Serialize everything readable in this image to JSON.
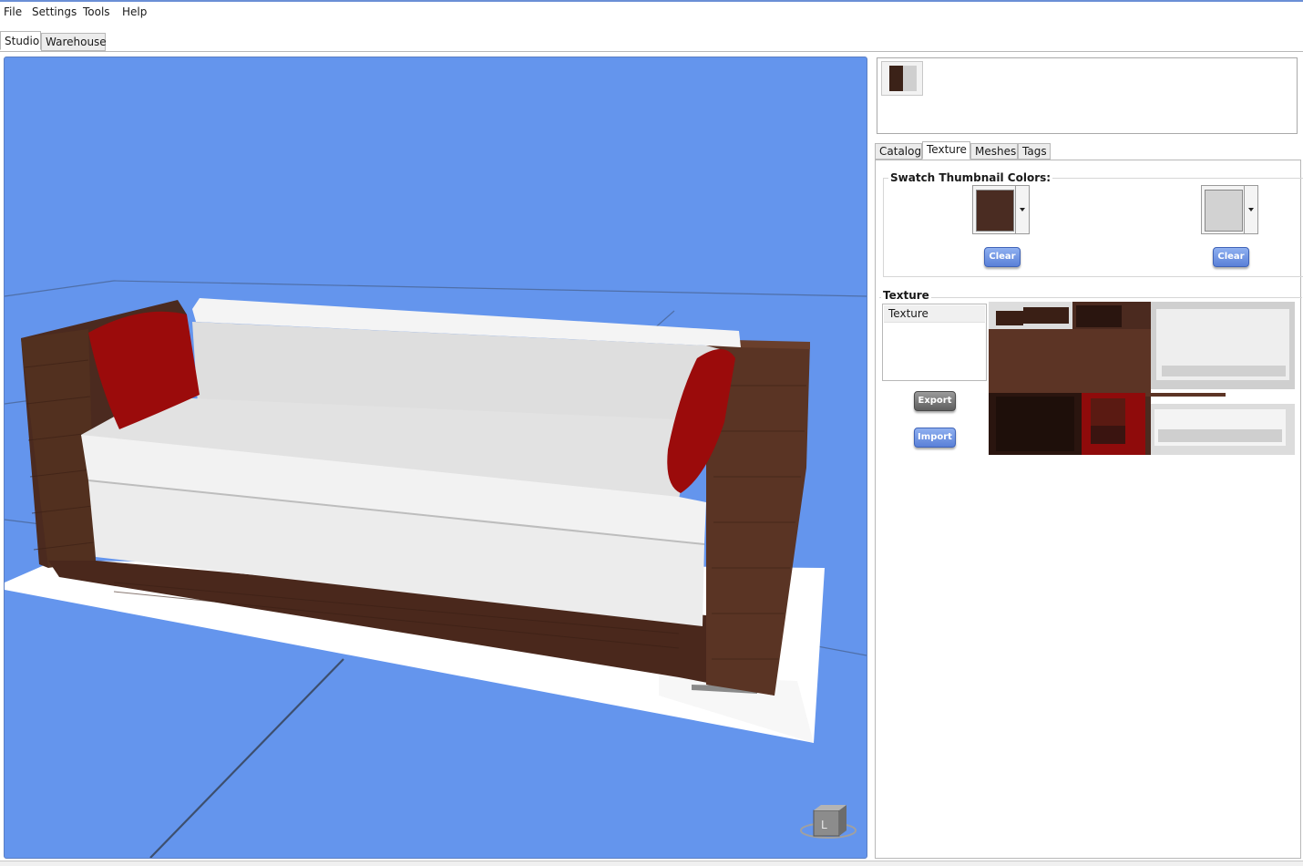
{
  "menubar": {
    "items": [
      "File",
      "Settings",
      "Tools",
      "Help"
    ]
  },
  "main_tabs": {
    "studio": "Studio",
    "warehouse": "Warehouse"
  },
  "preview": {
    "swatch_colors": [
      "#3b2218",
      "#cfcfcf"
    ]
  },
  "right_tabs": {
    "catalog": "Catalog",
    "texture": "Texture",
    "meshes": "Meshes",
    "tags": "Tags",
    "active": "Texture"
  },
  "swatch_group": {
    "title": "Swatch Thumbnail Colors:",
    "color1": "#4a2c22",
    "color2": "#d2d2d2",
    "clear_label": "Clear"
  },
  "texture_group": {
    "title": "Texture",
    "list_items": [
      "Texture"
    ],
    "export_label": "Export",
    "import_label": "Import"
  },
  "colors": {
    "viewport_bg": "#6495ed",
    "sofa_frame": "#4b2a1f",
    "cushion": "#e9e9e9",
    "pillow": "#9b0b0b"
  },
  "viewport": {
    "orientation_cube_label": "L"
  }
}
